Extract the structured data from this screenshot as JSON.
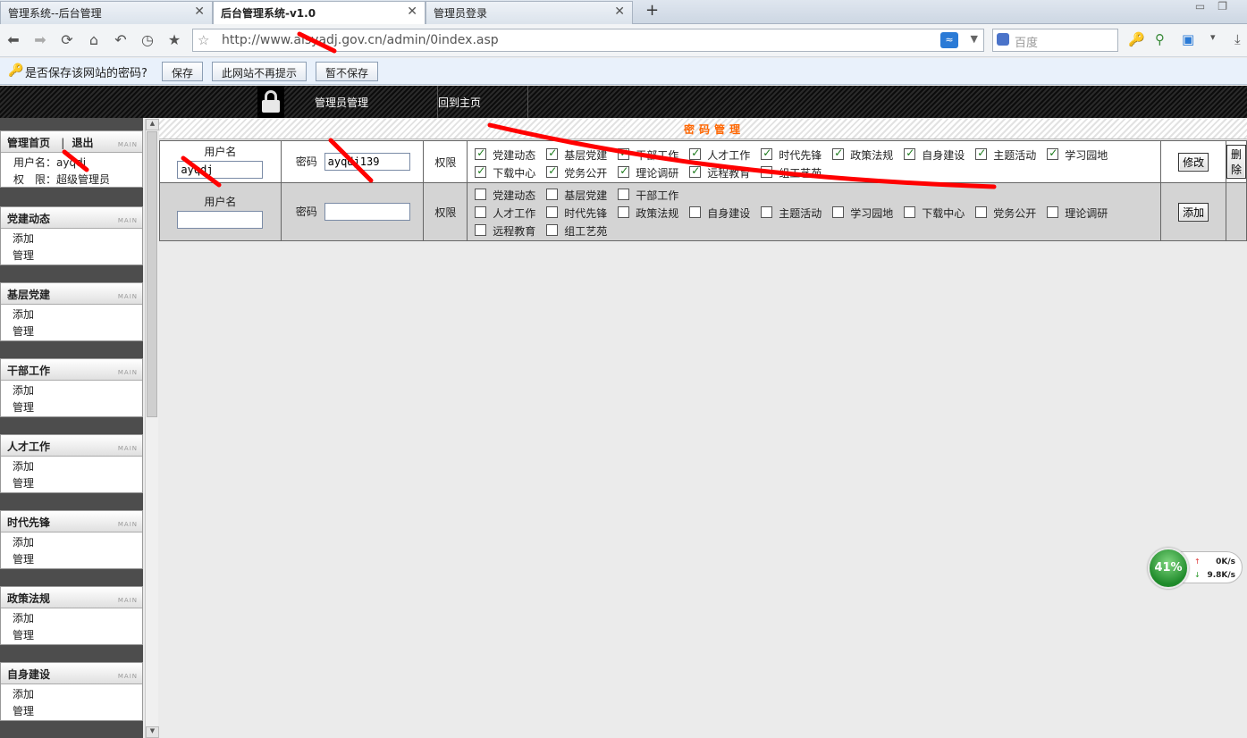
{
  "browser": {
    "tabs": [
      {
        "label": "管理系统--后台管理",
        "active": false
      },
      {
        "label": "后台管理系统-v1.0",
        "active": true
      },
      {
        "label": "管理员登录",
        "active": false
      }
    ],
    "new_tab_label": "+",
    "url": "http://www.alsyadj.gov.cn/admin/0index.asp",
    "search_placeholder": "百度",
    "password_bar": {
      "message": "是否保存该网站的密码?",
      "save_label": "保存",
      "never_label": "此网站不再提示",
      "not_now_label": "暂不保存"
    }
  },
  "header": {
    "nav": [
      "管理员管理",
      "回到主页"
    ]
  },
  "sidebar": {
    "home": {
      "title": "管理首页",
      "separator": "|",
      "logout": "退出",
      "tag": "MAIN",
      "info": [
        {
          "label": "用户名：",
          "value": "ayqdj"
        },
        {
          "label": "权　限：",
          "value": "超级管理员"
        }
      ]
    },
    "sections": [
      {
        "title": "党建动态",
        "tag": "MAIN",
        "items": [
          "添加",
          "管理"
        ]
      },
      {
        "title": "基层党建",
        "tag": "MAIN",
        "items": [
          "添加",
          "管理"
        ]
      },
      {
        "title": "干部工作",
        "tag": "MAIN",
        "items": [
          "添加",
          "管理"
        ]
      },
      {
        "title": "人才工作",
        "tag": "MAIN",
        "items": [
          "添加",
          "管理"
        ]
      },
      {
        "title": "时代先锋",
        "tag": "MAIN",
        "items": [
          "添加",
          "管理"
        ]
      },
      {
        "title": "政策法规",
        "tag": "MAIN",
        "items": [
          "添加",
          "管理"
        ]
      },
      {
        "title": "自身建设",
        "tag": "MAIN",
        "items": [
          "添加",
          "管理"
        ]
      }
    ]
  },
  "main": {
    "title": "密码管理",
    "username_label": "用户名",
    "password_label": "密码",
    "perm_label": "权限",
    "rows": [
      {
        "username": "ayqdj",
        "password": "ayqdj139",
        "perms": [
          {
            "label": "党建动态",
            "checked": true
          },
          {
            "label": "基层党建",
            "checked": true
          },
          {
            "label": "干部工作",
            "checked": true
          },
          {
            "label": "人才工作",
            "checked": true
          },
          {
            "label": "时代先锋",
            "checked": true
          },
          {
            "label": "政策法规",
            "checked": true
          },
          {
            "label": "自身建设",
            "checked": true
          },
          {
            "label": "主题活动",
            "checked": true
          },
          {
            "label": "学习园地",
            "checked": true
          },
          {
            "label": "下载中心",
            "checked": true
          },
          {
            "label": "党务公开",
            "checked": true
          },
          {
            "label": "理论调研",
            "checked": true
          },
          {
            "label": "远程教育",
            "checked": true
          },
          {
            "label": "组工艺苑",
            "checked": false
          }
        ],
        "edit_label": "修改",
        "delete_label": "删除"
      },
      {
        "username": "",
        "password": "",
        "perms": [
          {
            "label": "党建动态",
            "checked": false
          },
          {
            "label": "基层党建",
            "checked": false
          },
          {
            "label": "干部工作",
            "checked": false
          },
          {
            "label": "人才工作",
            "checked": false
          },
          {
            "label": "时代先锋",
            "checked": false
          },
          {
            "label": "政策法规",
            "checked": false
          },
          {
            "label": "自身建设",
            "checked": false
          },
          {
            "label": "主题活动",
            "checked": false
          },
          {
            "label": "学习园地",
            "checked": false
          },
          {
            "label": "下载中心",
            "checked": false
          },
          {
            "label": "党务公开",
            "checked": false
          },
          {
            "label": "理论调研",
            "checked": false
          },
          {
            "label": "远程教育",
            "checked": false
          },
          {
            "label": "组工艺苑",
            "checked": false
          }
        ],
        "add_label": "添加"
      }
    ]
  },
  "net_widget": {
    "percent": "41%",
    "upload": "0K/s",
    "download": "9.8K/s"
  },
  "colors": {
    "title_orange": "#ff6600",
    "annotation_red": "#ff0000",
    "header_black": "#111111"
  }
}
